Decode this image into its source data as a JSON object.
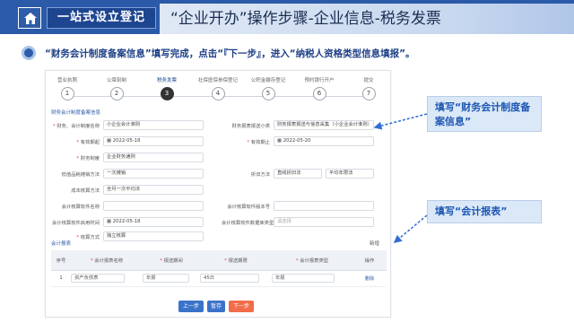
{
  "banner": {
    "left_title": "一站式设立登记",
    "right_title": "“企业开办”操作步骤-企业信息-税务发票"
  },
  "instruction": "“财务会计制度备案信息”填写完成，点击“『下一步』，进入“纳税人资格类型信息填报”。",
  "stepper": [
    {
      "label": "营业执照",
      "num": "1"
    },
    {
      "label": "公章刻制",
      "num": "2"
    },
    {
      "label": "税务发票",
      "num": "3",
      "active": true
    },
    {
      "label": "社保医保参保登记",
      "num": "4"
    },
    {
      "label": "公积金缴存登记",
      "num": "5"
    },
    {
      "label": "预约银行开户",
      "num": "6"
    },
    {
      "label": "提交",
      "num": "7"
    }
  ],
  "section_title": "财务会计制度备案信息",
  "form": {
    "f1_label": "财务、会计制度名称",
    "f1_value": "小企业会计准则",
    "f2_label": "财务报表报送小类",
    "f2_value": "财务报表报送与信息采集（小企业会计准则）",
    "f3_label": "有效期起",
    "f3_value": "2022-05-18",
    "f4_label": "有效期止",
    "f4_value": "2022-05-20",
    "f5_label": "财务制度",
    "f5_value": "企业财务通则",
    "f6_label": "低值品耗摊销方法",
    "f6_value": "一次摊销",
    "f7_label": "折旧方法",
    "f7_value_a": "直线折旧法",
    "f7_value_b": "平均年限法",
    "f8_label": "成本核算方法",
    "f8_value": "全月一次平均法",
    "f9_label": "会计核算软件名称",
    "f9_value": "",
    "f10_label": "会计核算软件版本号",
    "f10_value": "",
    "f11_label": "会计核算软件启用时间",
    "f11_value": "2022-05-18",
    "f12_label": "会计核算软件数据库类型",
    "f12_value": "请选择",
    "f13_label": "核算方式",
    "f13_value": "独立核算"
  },
  "table": {
    "title": "会计报表",
    "add_label": "新增",
    "headers": [
      "序号",
      "会计报表名称",
      "报送期间",
      "报送期限",
      "会计报表类型",
      "操作"
    ],
    "rows": [
      {
        "seq": "1",
        "name": "资产负债表",
        "period": "年报",
        "deadline": "45日",
        "type": "年报",
        "op": "删除"
      }
    ]
  },
  "buttons": {
    "prev": "上一步",
    "save": "暂存",
    "next": "下一步"
  },
  "callouts": {
    "c1": "填写“财务会计制度备案信息”",
    "c2": "填写“会计报表”"
  }
}
